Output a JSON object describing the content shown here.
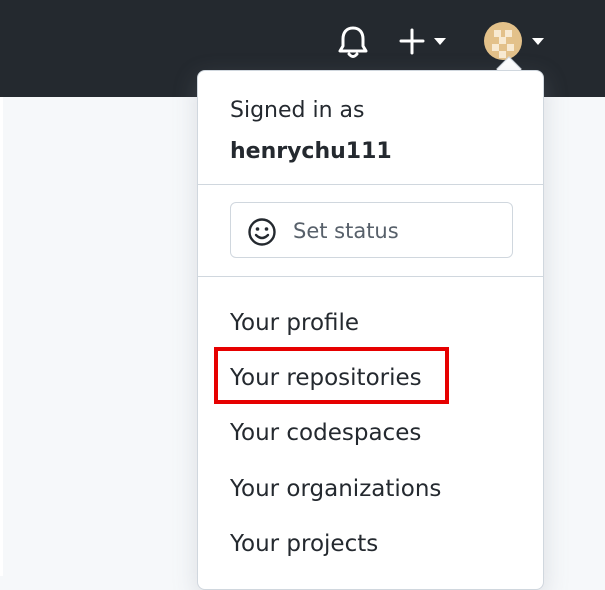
{
  "header": {
    "icons": {
      "notifications": "bell-icon",
      "create": "plus-icon",
      "avatar": "avatar-image"
    }
  },
  "dropdown": {
    "signed_in_label": "Signed in as",
    "username": "henrychu111",
    "status_button": {
      "icon": "smiley-icon",
      "label": "Set status"
    },
    "menu_items": [
      {
        "label": "Your profile"
      },
      {
        "label": "Your repositories"
      },
      {
        "label": "Your codespaces"
      },
      {
        "label": "Your organizations"
      },
      {
        "label": "Your projects"
      }
    ]
  },
  "annotation": {
    "highlight_color": "#e60000",
    "highlighted_item": "Your repositories"
  },
  "colors": {
    "header_bg": "#24292f",
    "page_bg": "#f6f8fa",
    "border": "#d0d7de",
    "text": "#24292f",
    "muted_text": "#57606a"
  }
}
